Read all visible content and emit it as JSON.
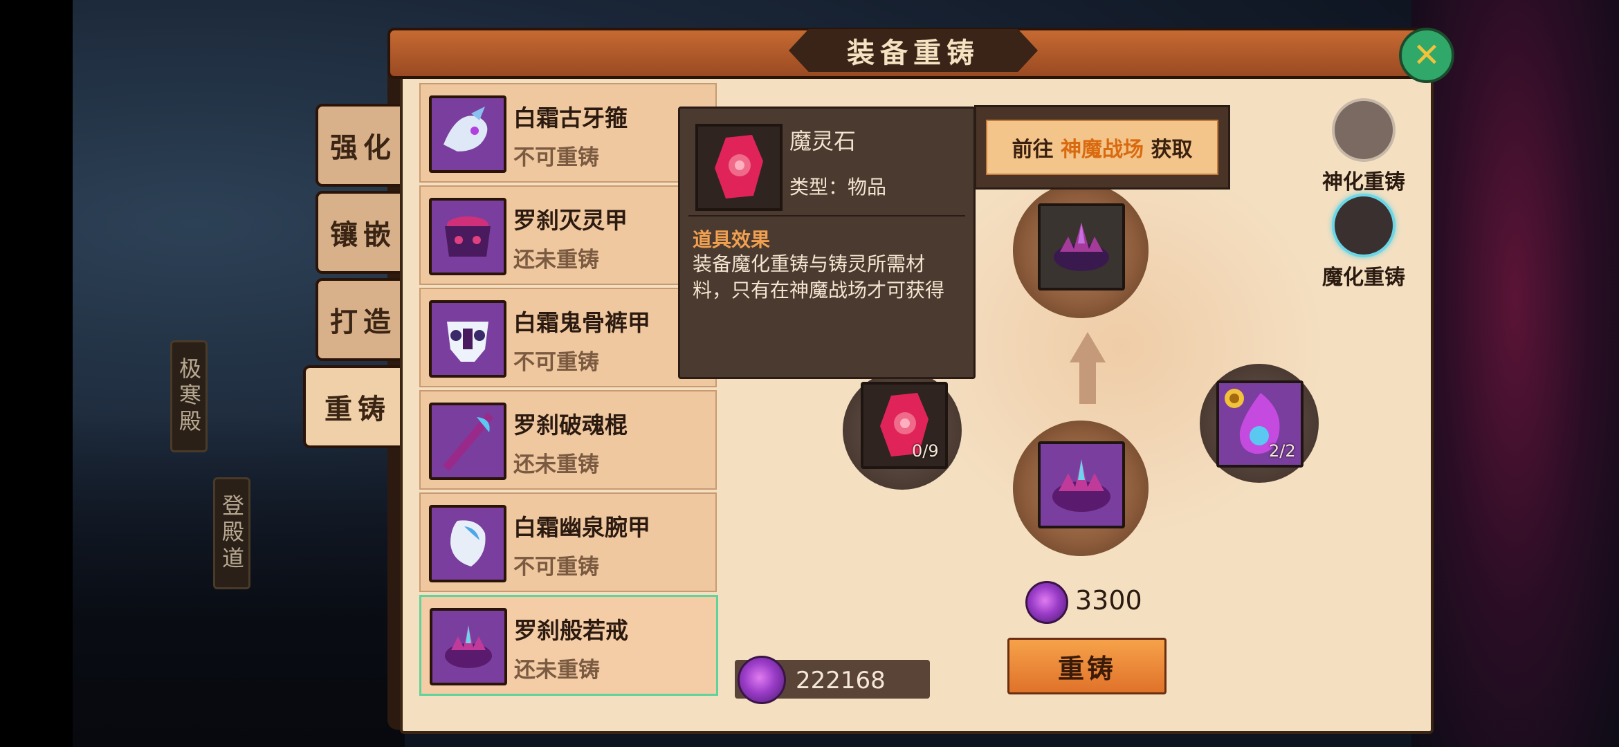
{
  "window": {
    "title": "装备重铸"
  },
  "side_signs": [
    {
      "label": "极寒殿"
    },
    {
      "label": "登殿道"
    }
  ],
  "tabs": [
    {
      "label": "强化"
    },
    {
      "label": "镶嵌"
    },
    {
      "label": "打造"
    },
    {
      "label": "重铸"
    }
  ],
  "items": [
    {
      "name": "白霜古牙箍",
      "status": "不可重铸"
    },
    {
      "name": "罗刹灭灵甲",
      "status": "还未重铸"
    },
    {
      "name": "白霜鬼骨裤甲",
      "status": "不可重铸"
    },
    {
      "name": "罗刹破魂棍",
      "status": "还未重铸"
    },
    {
      "name": "白霜幽泉腕甲",
      "status": "不可重铸"
    },
    {
      "name": "罗刹般若戒",
      "status": "还未重铸"
    }
  ],
  "currency": {
    "amount": "222168"
  },
  "tooltip": {
    "name": "魔灵石",
    "type": "类型：物品",
    "effect_title": "道具效果",
    "effect": "装备魔化重铸与铸灵所需材料，只有在神魔战场才可获得"
  },
  "goto": {
    "prefix": "前往",
    "place": "神魔战场",
    "suffix": "获取"
  },
  "modes": [
    {
      "label": "神化重铸"
    },
    {
      "label": "魔化重铸"
    }
  ],
  "materials": [
    {
      "count": "0/9"
    },
    {
      "count": "2/2"
    }
  ],
  "cost": {
    "amount": "3300"
  },
  "reforge_button": {
    "label": "重铸"
  },
  "colors": {
    "selected_border": "#5fd39a",
    "accent_orange": "#f6a24a",
    "panel_bg": "#f4dfc1"
  }
}
